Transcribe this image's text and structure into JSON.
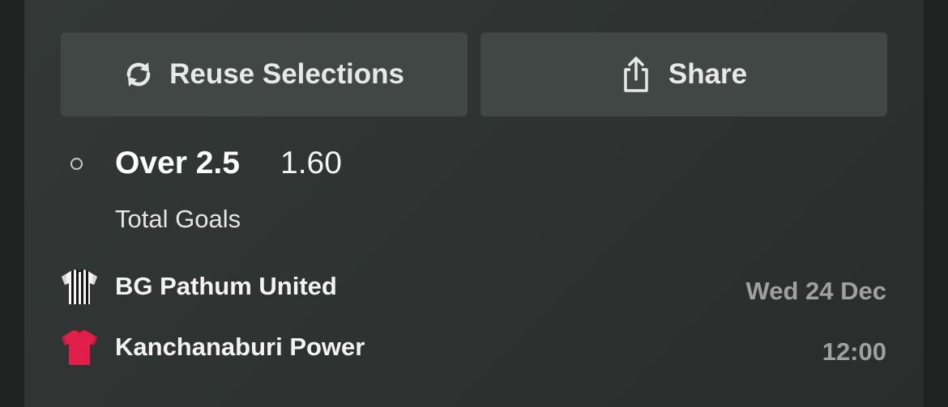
{
  "actions": {
    "reuse_label": "Reuse Selections",
    "reuse_icon": "refresh-icon",
    "share_label": "Share",
    "share_icon": "share-icon"
  },
  "selection": {
    "name": "Over 2.5",
    "odds": "1.60",
    "market": "Total Goals",
    "status_icon": "open-circle-icon"
  },
  "event": {
    "home_team": "BG Pathum United",
    "home_shirt_icon": "striped-shirt-icon",
    "away_team": "Kanchanaburi Power",
    "away_shirt_icon": "red-shirt-icon",
    "date": "Wed 24 Dec",
    "time": "12:00"
  },
  "colors": {
    "background": "#2e3331",
    "button": "#414744",
    "text_primary": "#ffffff",
    "text_muted": "#9ea19f",
    "away_shirt": "#e0204a"
  }
}
